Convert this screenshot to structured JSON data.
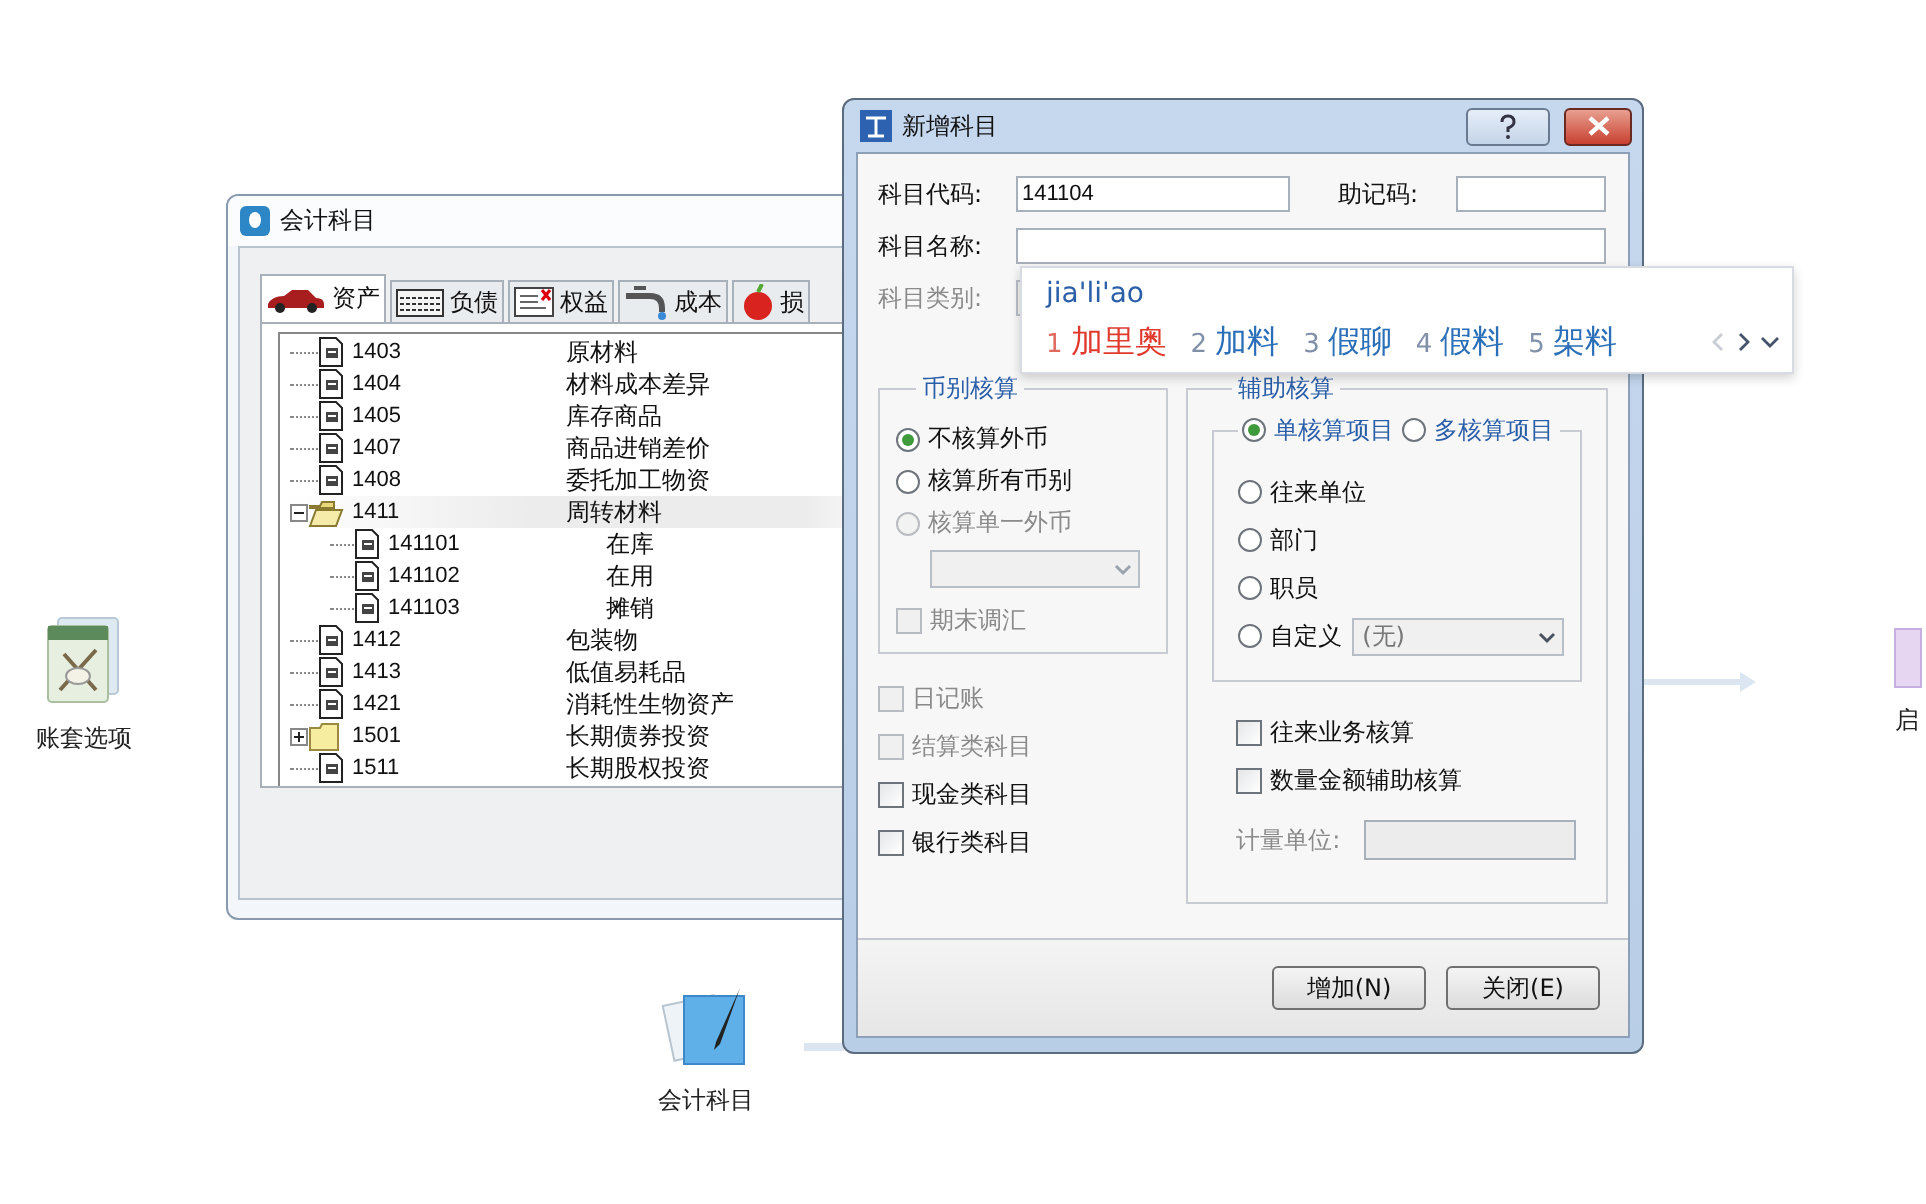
{
  "desktop_icons": [
    {
      "kind": "tools",
      "label": "账套选项"
    },
    {
      "kind": "pen",
      "label": "会计科目"
    },
    {
      "kind": "partial",
      "label": "启"
    }
  ],
  "accounts_window": {
    "title": "会计科目",
    "tabs": [
      {
        "kind": "car",
        "label": "资产",
        "selected": true
      },
      {
        "kind": "keyboard",
        "label": "负债",
        "selected": false
      },
      {
        "kind": "doc",
        "label": "权益",
        "selected": false
      },
      {
        "kind": "tap",
        "label": "成本",
        "selected": false
      },
      {
        "kind": "apple",
        "label": "损",
        "selected": false
      }
    ],
    "tree": [
      {
        "kind": "leaf",
        "code": "1403",
        "name": "原材料",
        "selected": false
      },
      {
        "kind": "leaf",
        "code": "1404",
        "name": "材料成本差异",
        "selected": false
      },
      {
        "kind": "leaf",
        "code": "1405",
        "name": "库存商品",
        "selected": false
      },
      {
        "kind": "leaf",
        "code": "1407",
        "name": "商品进销差价",
        "selected": false
      },
      {
        "kind": "leaf",
        "code": "1408",
        "name": "委托加工物资",
        "selected": false
      },
      {
        "kind": "folder",
        "code": "1411",
        "name": "周转材料",
        "selected": true,
        "expanded": true,
        "children": [
          {
            "kind": "leaf",
            "code": "141101",
            "name": "在库",
            "selected": false
          },
          {
            "kind": "leaf",
            "code": "141102",
            "name": "在用",
            "selected": false
          },
          {
            "kind": "leaf",
            "code": "141103",
            "name": "摊销",
            "selected": false
          }
        ]
      },
      {
        "kind": "leaf",
        "code": "1412",
        "name": "包装物",
        "selected": false
      },
      {
        "kind": "leaf",
        "code": "1413",
        "name": "低值易耗品",
        "selected": false
      },
      {
        "kind": "leaf",
        "code": "1421",
        "name": "消耗性生物资产",
        "selected": false
      },
      {
        "kind": "folder",
        "code": "1501",
        "name": "长期债券投资",
        "selected": false,
        "expanded": false
      },
      {
        "kind": "leaf",
        "code": "1511",
        "name": "长期股权投资",
        "selected": false
      }
    ]
  },
  "dialog": {
    "title": "新增科目",
    "code_field": {
      "label": "科目代码:",
      "value": "141104"
    },
    "mnemonic_field": {
      "label": "助记码:"
    },
    "name_field": {
      "label": "科目名称:"
    },
    "category_field": {
      "label": "科目类别:",
      "disabled": true
    },
    "currency_group": {
      "title": "币别核算",
      "options": [
        {
          "label": "不核算外币",
          "selected": true,
          "disabled": false
        },
        {
          "label": "核算所有币别",
          "selected": false,
          "disabled": false
        },
        {
          "label": "核算单一外币",
          "selected": false,
          "disabled": true
        }
      ],
      "currency_select": {
        "disabled": true
      },
      "period_end": {
        "label": "期末调汇",
        "checked": false,
        "disabled": true
      }
    },
    "flags": [
      {
        "label": "日记账",
        "checked": false,
        "disabled": true
      },
      {
        "label": "结算类科目",
        "checked": false,
        "disabled": true
      },
      {
        "label": "现金类科目",
        "checked": false,
        "disabled": false
      },
      {
        "label": "银行类科目",
        "checked": false,
        "disabled": false
      }
    ],
    "aux_group": {
      "title": "辅助核算",
      "modes": [
        {
          "label": "单核算项目",
          "selected": true
        },
        {
          "label": "多核算项目",
          "selected": false
        }
      ],
      "items": [
        {
          "kind": "radio",
          "label": "往来单位",
          "selected": false
        },
        {
          "kind": "radio",
          "label": "部门",
          "selected": false
        },
        {
          "kind": "radio",
          "label": "职员",
          "selected": false
        },
        {
          "kind": "radio_select",
          "label": "自定义",
          "selected": false,
          "select_value": "(无)"
        }
      ],
      "checks": [
        {
          "label": "往来业务核算",
          "checked": false
        },
        {
          "label": "数量金额辅助核算",
          "checked": false
        }
      ],
      "unit_field": {
        "label": "计量单位:",
        "disabled": true
      }
    },
    "buttons": [
      {
        "label": "增加(N)"
      },
      {
        "label": "关闭(E)"
      }
    ]
  },
  "ime": {
    "composition": "jia'li'ao",
    "candidates": [
      {
        "index": "1",
        "text": "加里奥",
        "selected": true
      },
      {
        "index": "2",
        "text": "加料",
        "selected": false
      },
      {
        "index": "3",
        "text": "假聊",
        "selected": false
      },
      {
        "index": "4",
        "text": "假料",
        "selected": false
      },
      {
        "index": "5",
        "text": "架料",
        "selected": false
      }
    ]
  }
}
